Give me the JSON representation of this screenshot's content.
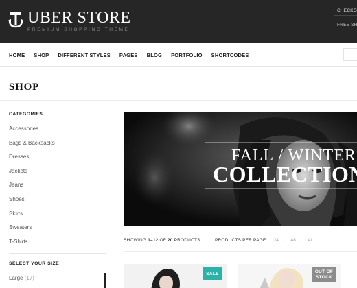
{
  "header": {
    "logo_title": "UBER STORE",
    "logo_subtitle": "PREMIUM SHOPPING THEME",
    "links": [
      "CHECKOUT",
      "FREE SHIPPING"
    ]
  },
  "nav": {
    "items": [
      "HOME",
      "SHOP",
      "DIFFERENT STYLES",
      "PAGES",
      "BLOG",
      "PORTFOLIO",
      "SHORTCODES"
    ]
  },
  "page": {
    "title": "SHOP"
  },
  "sidebar": {
    "categories_heading": "CATEGORIES",
    "categories": [
      "Accessories",
      "Bags & Backpacks",
      "Dresses",
      "Jackets",
      "Jeans",
      "Shoes",
      "Skirts",
      "Sweaters",
      "T-Shirts"
    ],
    "size_heading": "SELECT YOUR SIZE",
    "size_item": {
      "label": "Large",
      "count": "(17)"
    }
  },
  "banner": {
    "line1": "FALL / WINTER",
    "line2": "COLLECTION"
  },
  "results": {
    "prefix": "SHOWING",
    "range": "1–12",
    "of": "OF",
    "total": "20",
    "suffix": "PRODUCTS",
    "per_page_label": "PRODUCTS PER PAGE:",
    "per_page_options": [
      "24",
      "48",
      "ALL"
    ]
  },
  "products": {
    "sale_badge": "SALE",
    "out_of_stock_line1": "OUT OF",
    "out_of_stock_line2": "STOCK"
  },
  "colors": {
    "header_bg": "#262626",
    "sale_badge": "#2ab3a6",
    "oos_badge": "#8c8c8c"
  }
}
